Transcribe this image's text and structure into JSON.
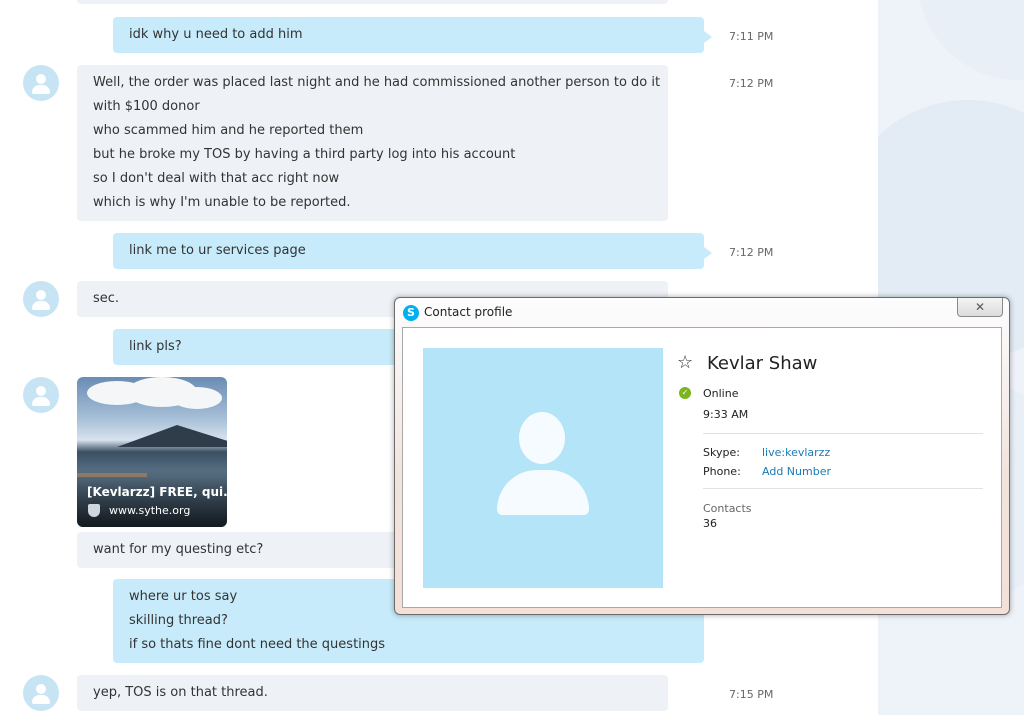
{
  "messages": [
    {
      "id": "m1",
      "direction": "out",
      "lines": [
        "idk why u need to add him"
      ],
      "time": "7:11 PM"
    },
    {
      "id": "m2",
      "direction": "in",
      "lines": [
        "Well, the order was placed last night and he had commissioned another person to do it",
        "with $100 donor",
        "who scammed him and he reported them",
        "but he broke my TOS by having a third party log into his account",
        "so I don't deal with that acc right now",
        "which is why I'm unable to be reported."
      ],
      "time": "7:12 PM"
    },
    {
      "id": "m3",
      "direction": "out",
      "lines": [
        "link me to ur services page"
      ],
      "time": "7:12 PM"
    },
    {
      "id": "m4",
      "direction": "in",
      "lines": [
        "sec."
      ],
      "time": ""
    },
    {
      "id": "m5",
      "direction": "out",
      "lines": [
        "link pls?"
      ],
      "time": ""
    },
    {
      "id": "m6",
      "direction": "in",
      "lines": [
        "want for my questing etc?"
      ],
      "time": ""
    },
    {
      "id": "m7",
      "direction": "out",
      "lines": [
        "where ur tos say",
        "skilling thread?",
        "if so thats fine dont need the questings"
      ],
      "time": ""
    },
    {
      "id": "m8",
      "direction": "in",
      "lines": [
        "yep, TOS is on that thread."
      ],
      "time": "7:15 PM"
    }
  ],
  "link_preview": {
    "title": "[Kevlarzz] FREE, qui...",
    "site": "www.sythe.org"
  },
  "dialog": {
    "title": "Contact profile",
    "close_label": "✕",
    "contact_name": "Kevlar Shaw",
    "status": "Online",
    "local_time": "9:33 AM",
    "skype_label": "Skype:",
    "skype_value": "live:kevlarzz",
    "phone_label": "Phone:",
    "phone_value": "Add Number",
    "contacts_label": "Contacts",
    "contacts_count": "36"
  },
  "colors": {
    "outgoing_bubble": "#c7ebfa",
    "incoming_bubble": "#eef1f6",
    "avatar": "#c7e4f5",
    "link": "#1a7ab5",
    "online": "#7ab51d"
  },
  "icons": {
    "avatar": "person-avatar-icon",
    "star": "favorite-star-icon",
    "status": "online-check-icon",
    "app": "skype-icon",
    "close": "close-icon"
  }
}
